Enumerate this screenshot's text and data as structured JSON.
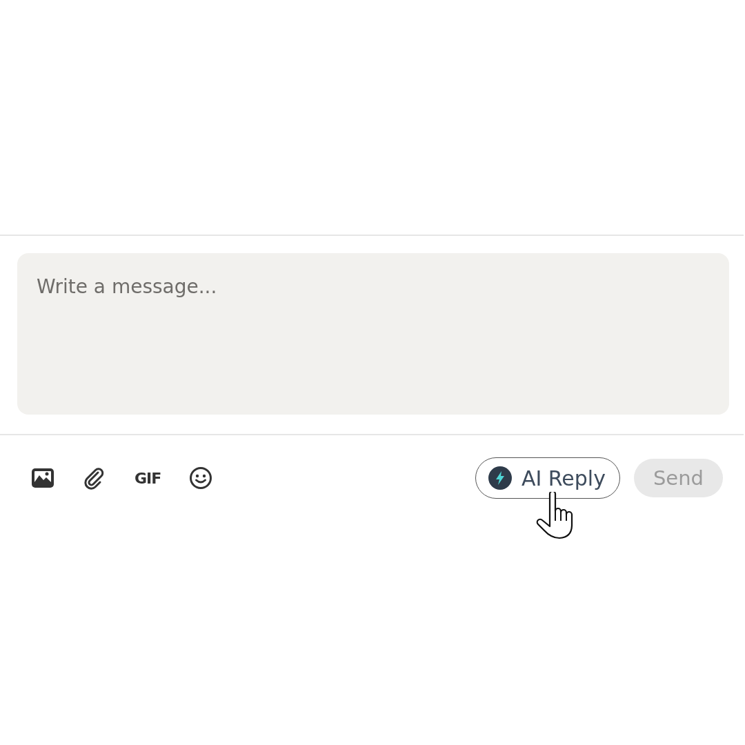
{
  "composer": {
    "placeholder": "Write a message..."
  },
  "toolbar": [
    {
      "kind": "image"
    },
    {
      "kind": "attachment"
    },
    {
      "kind": "gif",
      "label": "GIF"
    },
    {
      "kind": "emoji"
    }
  ],
  "ai_reply_button": {
    "label": "AI Reply",
    "hovered": true
  },
  "send_button": {
    "label": "Send",
    "disabled": true
  }
}
